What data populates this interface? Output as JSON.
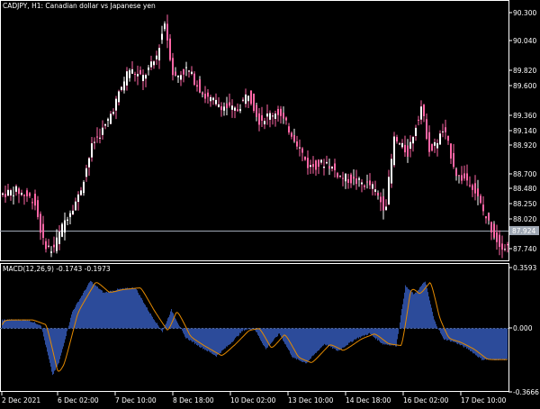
{
  "window": {
    "title_prefix": "CADJPY,",
    "title_tf": "H1:",
    "title_desc": "Canadian dollar vs Japanese yen"
  },
  "colors": {
    "background": "#000000",
    "candle": "#ff66a6",
    "candle_alt": "#ffffff",
    "axis": "#ffffff",
    "macd_fill": "#2c4b9a",
    "signal": "#e58a00",
    "price_tag_bg": "#9fa8b4",
    "price_line": "#9fa8b4"
  },
  "indicator": {
    "label": "MACD(12,26,9) -0.1743 -0.1973",
    "ticks": [
      "0.3593",
      "0.000",
      "-0.3666"
    ]
  },
  "price_axis": {
    "ticks": [
      "90.300",
      "90.040",
      "89.820",
      "89.600",
      "89.360",
      "89.140",
      "88.920",
      "88.700",
      "88.480",
      "88.250",
      "88.020",
      "87.740"
    ],
    "current_price": "87.924"
  },
  "time_axis": {
    "labels": [
      "2 Dec 2021",
      "6 Dec 02:00",
      "7 Dec 10:00",
      "8 Dec 18:00",
      "10 Dec 02:00",
      "13 Dec 10:00",
      "14 Dec 18:00",
      "16 Dec 02:00",
      "17 Dec 10:00"
    ]
  },
  "chart_data": {
    "type": "line",
    "symbol": "CADJPY",
    "timeframe": "H1",
    "price_keypoints": [
      [
        0,
        88.35
      ],
      [
        20,
        88.4
      ],
      [
        40,
        88.3
      ],
      [
        50,
        87.85
      ],
      [
        60,
        87.75
      ],
      [
        75,
        88.1
      ],
      [
        90,
        88.35
      ],
      [
        105,
        88.9
      ],
      [
        120,
        89.1
      ],
      [
        135,
        89.45
      ],
      [
        145,
        89.7
      ],
      [
        160,
        89.6
      ],
      [
        175,
        89.8
      ],
      [
        185,
        90.2
      ],
      [
        195,
        89.6
      ],
      [
        210,
        89.7
      ],
      [
        230,
        89.4
      ],
      [
        250,
        89.3
      ],
      [
        265,
        89.25
      ],
      [
        278,
        89.45
      ],
      [
        290,
        89.15
      ],
      [
        310,
        89.25
      ],
      [
        330,
        88.95
      ],
      [
        345,
        88.65
      ],
      [
        365,
        88.7
      ],
      [
        380,
        88.55
      ],
      [
        395,
        88.5
      ],
      [
        415,
        88.45
      ],
      [
        430,
        88.2
      ],
      [
        440,
        88.95
      ],
      [
        455,
        88.8
      ],
      [
        470,
        89.3
      ],
      [
        480,
        88.8
      ],
      [
        495,
        89.05
      ],
      [
        510,
        88.55
      ],
      [
        525,
        88.5
      ],
      [
        540,
        88.15
      ],
      [
        555,
        87.85
      ],
      [
        562,
        87.8
      ]
    ],
    "macd_keypoints": [
      [
        0,
        0.05
      ],
      [
        30,
        0.05
      ],
      [
        45,
        0.02
      ],
      [
        58,
        -0.27
      ],
      [
        65,
        -0.2
      ],
      [
        80,
        0.1
      ],
      [
        100,
        0.28
      ],
      [
        115,
        0.21
      ],
      [
        130,
        0.23
      ],
      [
        150,
        0.24
      ],
      [
        165,
        0.1
      ],
      [
        180,
        -0.02
      ],
      [
        190,
        0.11
      ],
      [
        205,
        -0.05
      ],
      [
        220,
        -0.1
      ],
      [
        240,
        -0.16
      ],
      [
        255,
        -0.09
      ],
      [
        270,
        -0.01
      ],
      [
        282,
        0.0
      ],
      [
        295,
        -0.12
      ],
      [
        310,
        -0.03
      ],
      [
        325,
        -0.17
      ],
      [
        340,
        -0.2
      ],
      [
        360,
        -0.09
      ],
      [
        375,
        -0.13
      ],
      [
        395,
        -0.06
      ],
      [
        410,
        -0.03
      ],
      [
        425,
        -0.09
      ],
      [
        440,
        -0.1
      ],
      [
        450,
        0.25
      ],
      [
        460,
        0.2
      ],
      [
        472,
        0.28
      ],
      [
        482,
        0.05
      ],
      [
        492,
        -0.06
      ],
      [
        505,
        -0.08
      ],
      [
        520,
        -0.12
      ],
      [
        535,
        -0.18
      ],
      [
        550,
        -0.18
      ],
      [
        565,
        -0.18
      ]
    ],
    "macd_ylim": [
      -0.3666,
      0.3593
    ],
    "price_ylim": [
      87.7,
      90.36
    ]
  }
}
